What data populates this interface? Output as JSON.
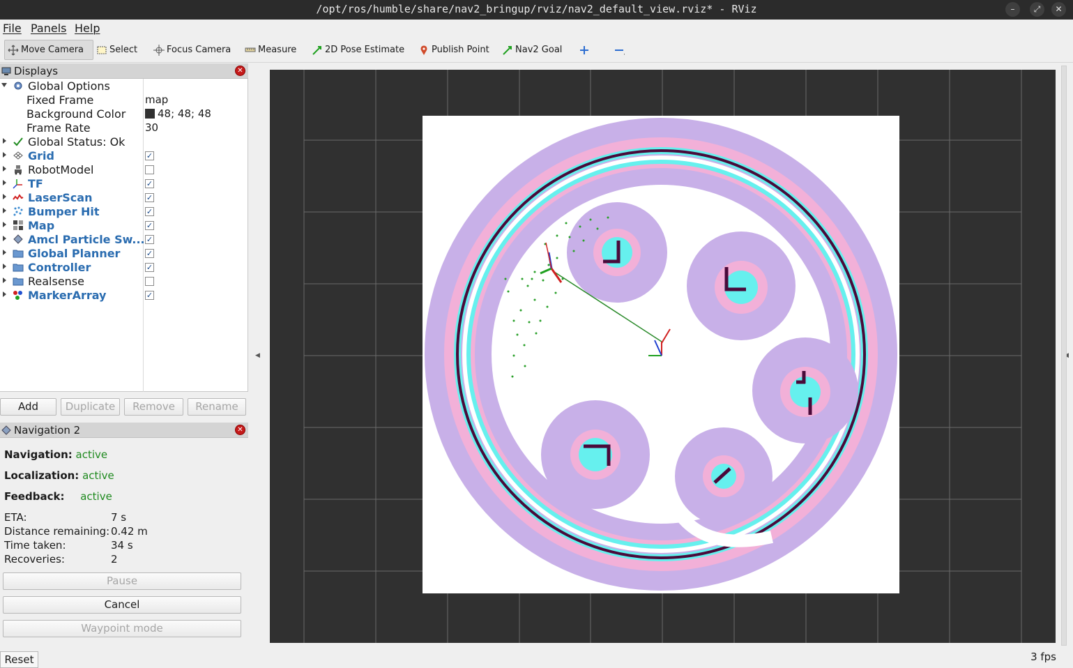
{
  "window": {
    "title": "/opt/ros/humble/share/nav2_bringup/rviz/nav2_default_view.rviz* - RViz",
    "buttons": {
      "minimize": "–",
      "maximize": "⤢",
      "close": "✕"
    }
  },
  "menu": [
    "File",
    "Panels",
    "Help"
  ],
  "toolbar": {
    "tools": [
      "Move Camera",
      "Select",
      "Focus Camera",
      "Measure",
      "2D Pose Estimate",
      "Publish Point",
      "Nav2 Goal"
    ],
    "plus_icon": "plus-icon",
    "minus_icon": "minus-icon"
  },
  "displays": {
    "title": "Displays",
    "global_options": {
      "label": "Global Options",
      "fixed_frame_label": "Fixed Frame",
      "fixed_frame_value": "map",
      "background_color_label": "Background Color",
      "background_color_value": "48; 48; 48",
      "frame_rate_label": "Frame Rate",
      "frame_rate_value": "30"
    },
    "global_status": "Global Status: Ok",
    "items": [
      {
        "label": "Grid",
        "checked": true
      },
      {
        "label": "RobotModel",
        "checked": false
      },
      {
        "label": "TF",
        "checked": true
      },
      {
        "label": "LaserScan",
        "checked": true
      },
      {
        "label": "Bumper Hit",
        "checked": true
      },
      {
        "label": "Map",
        "checked": true
      },
      {
        "label": "Amcl Particle Sw...",
        "checked": true
      },
      {
        "label": "Global Planner",
        "checked": true
      },
      {
        "label": "Controller",
        "checked": true
      },
      {
        "label": "Realsense",
        "checked": false
      },
      {
        "label": "MarkerArray",
        "checked": true
      }
    ],
    "buttons": {
      "add": "Add",
      "duplicate": "Duplicate",
      "remove": "Remove",
      "rename": "Rename"
    }
  },
  "navigation": {
    "title": "Navigation 2",
    "status": [
      {
        "label": "Navigation:",
        "value": "active"
      },
      {
        "label": "Localization:",
        "value": "active"
      },
      {
        "label": "Feedback:",
        "value": "active"
      }
    ],
    "eta_label": "ETA:",
    "eta_value": "7 s",
    "distance_label": "Distance remaining:",
    "distance_value": "0.42 m",
    "time_label": "Time taken:",
    "time_value": "34 s",
    "recoveries_label": "Recoveries:",
    "recoveries_value": "2",
    "pause": "Pause",
    "cancel": "Cancel",
    "waypoint": "Waypoint mode"
  },
  "status_bar": {
    "reset": "Reset",
    "fps": "3 fps"
  },
  "colors": {
    "viewport_bg": "#303030",
    "costmap_outer": "#c8b0e8",
    "costmap_mid": "#f2b0d8",
    "inflation": "#66f0ee",
    "obstacle": "#4a0a3a"
  }
}
